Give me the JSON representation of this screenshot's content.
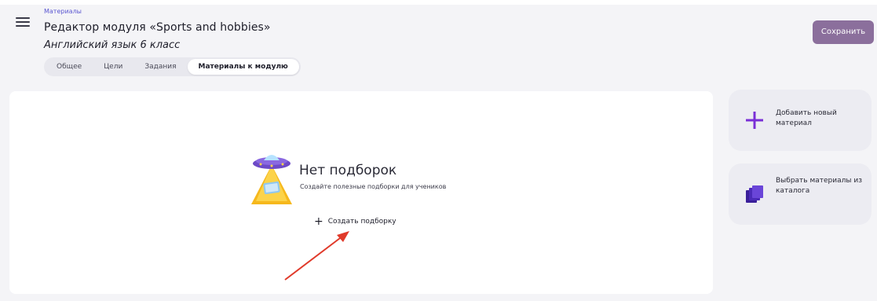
{
  "header": {
    "breadcrumb": "Материалы",
    "title": "Редактор модуля «Sports and hobbies»",
    "subtitle": "Английский язык 6 класс",
    "save_label": "Сохранить",
    "tabs": [
      {
        "label": "Общее",
        "active": false
      },
      {
        "label": "Цели",
        "active": false
      },
      {
        "label": "Задания",
        "active": false
      },
      {
        "label": "Материалы к модулю",
        "active": true
      }
    ]
  },
  "empty_state": {
    "title": "Нет подборок",
    "description": "Создайте полезные подборки для учеников",
    "create_label": "Создать подборку",
    "illustration": "ufo-icon"
  },
  "side_actions": [
    {
      "label": "Добавить новый материал",
      "icon": "plus-icon"
    },
    {
      "label": "Выбрать материалы из каталога",
      "icon": "books-icon"
    }
  ],
  "colors": {
    "accent": "#5b57d1",
    "save_button": "#8b6f9c",
    "plus_icon": "#7a2fd6",
    "books_icon": "#4b2ab8",
    "annotation_arrow": "#e03a2a",
    "side_card_bg": "#ececf2"
  }
}
